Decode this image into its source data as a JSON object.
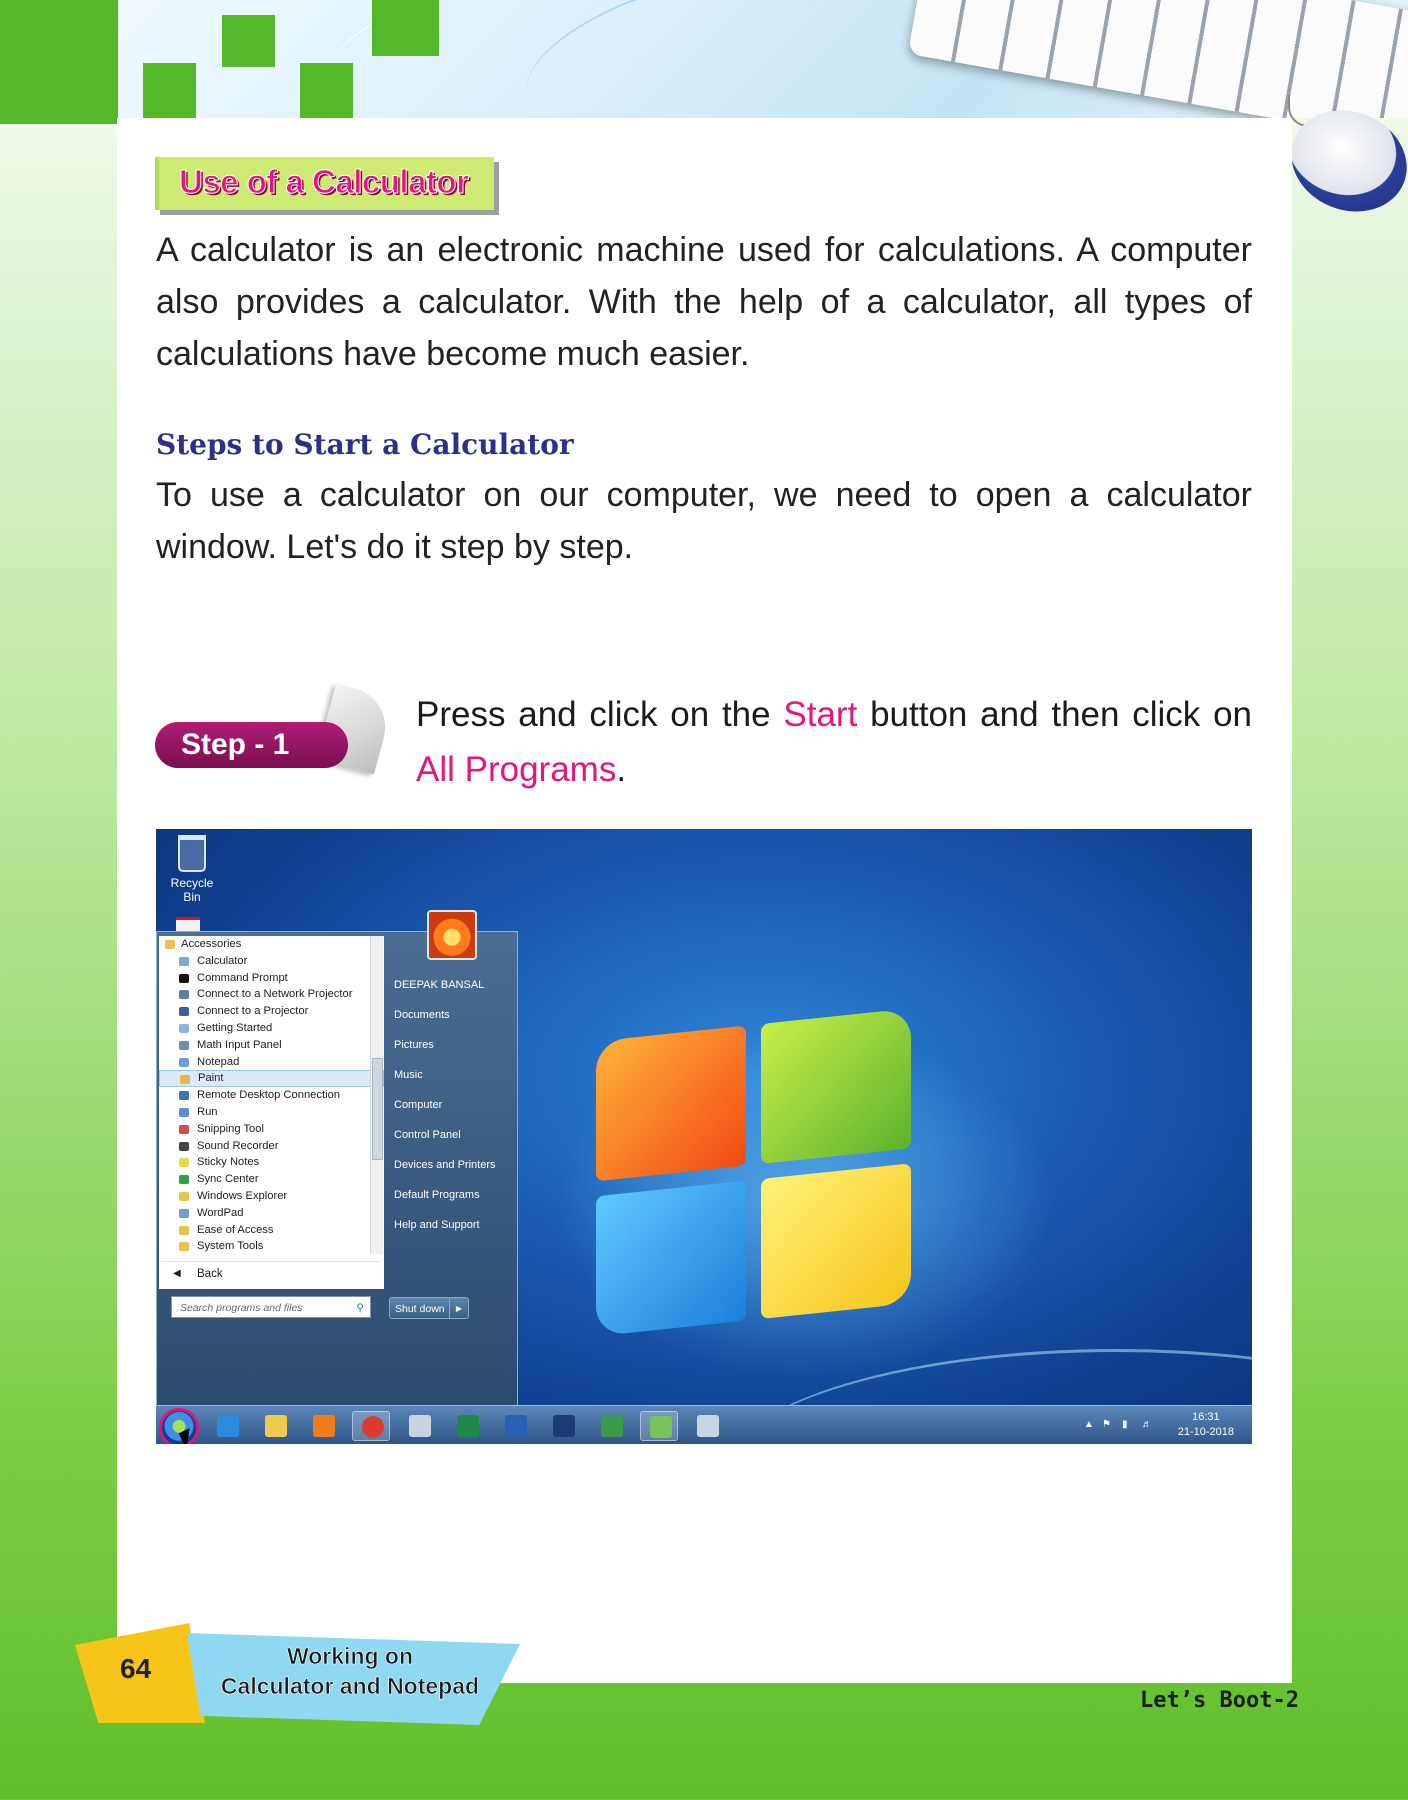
{
  "section_title": "Use of a Calculator",
  "intro": "A calculator is an electronic machine used for calculations. A computer also provides a calculator. With the help of a calculator, all types of calculations have become much easier.",
  "steps_heading": "Steps to Start a Calculator",
  "steps_intro": "To use a calculator on our computer, we need to open a calculator window. Let's do it step by step.",
  "step1": {
    "badge": "Step - 1",
    "text_before": "Press and click on the ",
    "start": "Start",
    "text_middle": " button and then click on ",
    "all_programs": "All Programs",
    "text_after": "."
  },
  "screenshot": {
    "desktop_icon": "Recycle Bin",
    "programs": {
      "header": "Accessories",
      "items": [
        {
          "label": "Calculator",
          "color": "#7aa7d6"
        },
        {
          "label": "Command Prompt",
          "color": "#111111"
        },
        {
          "label": "Connect to a Network Projector",
          "color": "#5d7fa6"
        },
        {
          "label": "Connect to a Projector",
          "color": "#3b5f9a"
        },
        {
          "label": "Getting Started",
          "color": "#8ab6e0"
        },
        {
          "label": "Math Input Panel",
          "color": "#6f8fb0"
        },
        {
          "label": "Notepad",
          "color": "#6e9fd0"
        },
        {
          "label": "Paint",
          "color": "#e8b54a"
        },
        {
          "label": "Remote Desktop Connection",
          "color": "#3d70b6"
        },
        {
          "label": "Run",
          "color": "#5b8fcf"
        },
        {
          "label": "Snipping Tool",
          "color": "#d94c4c"
        },
        {
          "label": "Sound Recorder",
          "color": "#444444"
        },
        {
          "label": "Sticky Notes",
          "color": "#e7d54a"
        },
        {
          "label": "Sync Center",
          "color": "#2fa34a"
        },
        {
          "label": "Windows Explorer",
          "color": "#e7c24c"
        },
        {
          "label": "WordPad",
          "color": "#6e9fd0"
        },
        {
          "label": "Ease of Access",
          "color": "#e7c24c"
        },
        {
          "label": "System Tools",
          "color": "#e7c24c"
        }
      ],
      "selected": "Paint",
      "back": "Back",
      "search_placeholder": "Search programs and files"
    },
    "right_menu": [
      "DEEPAK BANSAL",
      "Documents",
      "Pictures",
      "Music",
      "Computer",
      "Control Panel",
      "Devices and Printers",
      "Default Programs",
      "Help and Support"
    ],
    "shutdown": "Shut down",
    "taskbar_icons": [
      {
        "name": "internet-explorer-icon",
        "color": "#2a8bdc"
      },
      {
        "name": "file-explorer-icon",
        "color": "#f0c94e"
      },
      {
        "name": "media-player-icon",
        "color": "#ef7d1a"
      },
      {
        "name": "chrome-icon",
        "color": "#db3b2f"
      },
      {
        "name": "airplane-icon",
        "color": "#c9d3de"
      },
      {
        "name": "excel-icon",
        "color": "#1f8a45"
      },
      {
        "name": "word-icon",
        "color": "#2b5fb3"
      },
      {
        "name": "photoshop-icon",
        "color": "#1a3c73"
      },
      {
        "name": "paint-app-icon",
        "color": "#3a9a4c"
      },
      {
        "name": "app-icon",
        "color": "#79c35a"
      },
      {
        "name": "app2-icon",
        "color": "#c7d4e2"
      }
    ],
    "clock": {
      "time": "16:31",
      "date": "21-10-2018"
    }
  },
  "footer": {
    "page": "64",
    "chapter_line1": "Working on",
    "chapter_line2": "Calculator and Notepad",
    "book": "Let’s Boot-2"
  },
  "colors": {
    "accent_pink": "#e6157d",
    "heading_navy": "#2e2f86",
    "green": "#55b82b"
  }
}
